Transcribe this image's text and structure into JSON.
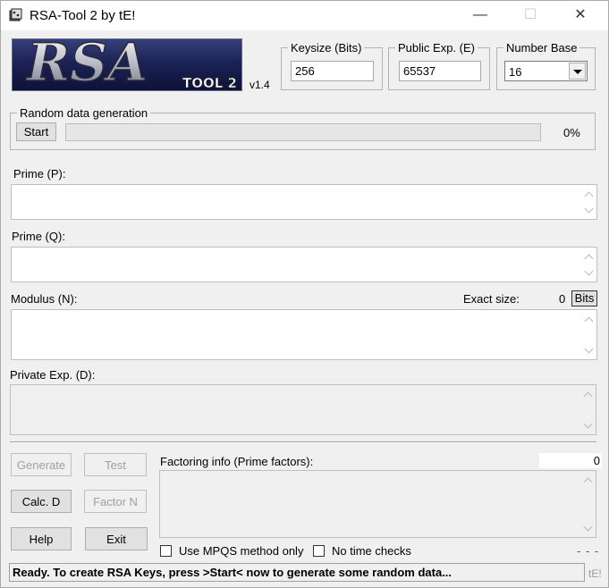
{
  "window": {
    "title": "RSA-Tool 2 by tE!",
    "minimize_glyph": "—",
    "maximize_glyph": "☐",
    "close_glyph": "✕"
  },
  "logo": {
    "text": "RSA",
    "subtext": "TOOL 2",
    "version": "v1.4"
  },
  "keysize": {
    "legend": "Keysize (Bits)",
    "value": "256"
  },
  "public_exp": {
    "legend": "Public Exp. (E)",
    "value": "65537"
  },
  "number_base": {
    "legend": "Number Base",
    "value": "16"
  },
  "random": {
    "legend": "Random data generation",
    "start_label": "Start",
    "progress": 0,
    "percent_text": "0%"
  },
  "prime_p": {
    "label": "Prime (P):"
  },
  "prime_q": {
    "label": "Prime (Q):"
  },
  "modulus": {
    "label": "Modulus (N):",
    "exact_size_label": "Exact size:",
    "exact_size_value": "0",
    "bits_label": "Bits"
  },
  "private_exp": {
    "label": "Private Exp. (D):"
  },
  "buttons": {
    "generate": "Generate",
    "test": "Test",
    "calc_d": "Calc. D",
    "factor_n": "Factor N",
    "help": "Help",
    "exit": "Exit"
  },
  "factoring": {
    "label": "Factoring info (Prime factors):",
    "count": "0"
  },
  "options": {
    "mpqs": "Use MPQS method only",
    "no_time": "No time checks",
    "dashes": "- - -"
  },
  "status": {
    "text": "Ready. To create RSA Keys, press >Start< now to generate some random data...",
    "corner": "tE!"
  }
}
